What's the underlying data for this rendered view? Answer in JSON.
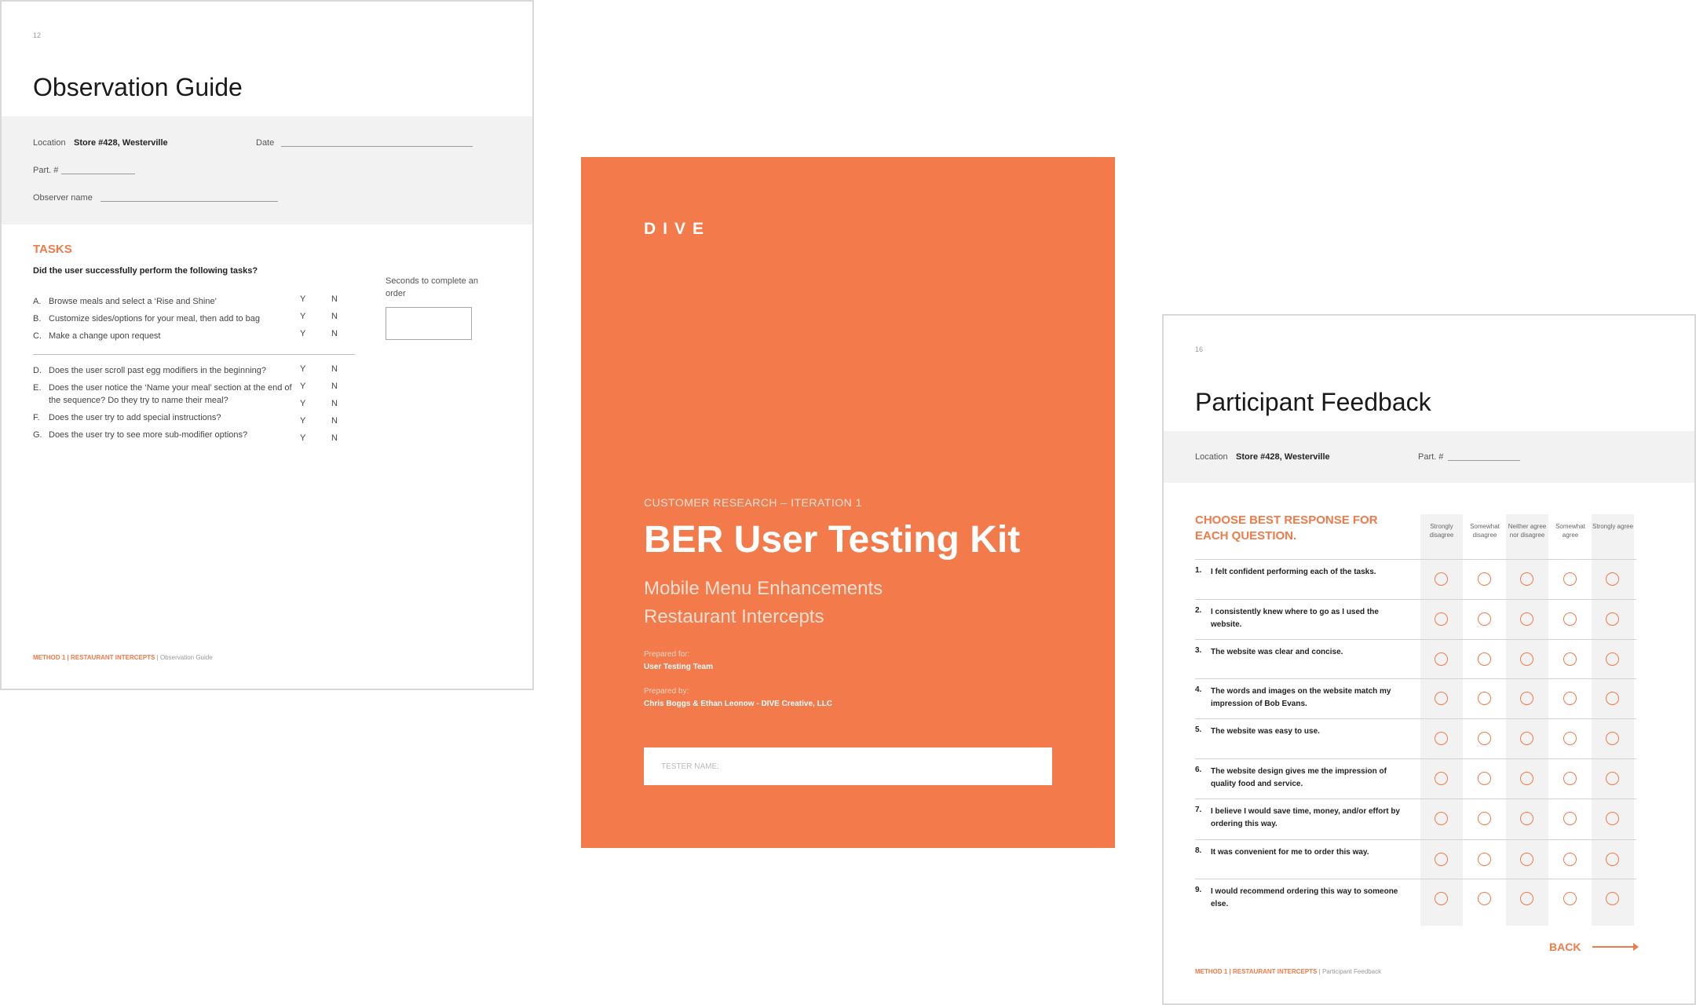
{
  "observation": {
    "page_number": "12",
    "title": "Observation Guide",
    "location_label": "Location",
    "location_value": "Store #428, Westerville",
    "date_label": "Date",
    "part_label": "Part. #",
    "observer_label": "Observer name",
    "tasks_heading": "TASKS",
    "tasks_question": "Did the user successfully perform the following tasks?",
    "seconds_label": "Seconds to complete an order",
    "yes": "Y",
    "no": "N",
    "tasks": [
      {
        "letter": "A.",
        "text": "Browse meals and select a ‘Rise and Shine’"
      },
      {
        "letter": "B.",
        "text": "Customize sides/options for your meal, then add to bag"
      },
      {
        "letter": "C.",
        "text": "Make a change upon request"
      },
      {
        "letter": "D.",
        "text": "Does the user scroll past egg modifiers in the beginning?"
      },
      {
        "letter": "E.",
        "text": "Does the user notice the ‘Name your meal’ section at the end of the sequence?  Do they try to name their meal?"
      },
      {
        "letter": "F.",
        "text": "Does the user try to add special instructions?"
      },
      {
        "letter": "G.",
        "text": "Does the user try to see more sub-modifier options?"
      }
    ],
    "footer_method": "METHOD 1 | RESTAURANT INTERCEPTS",
    "footer_page": " | Observation Guide"
  },
  "cover": {
    "brand": "DIVE",
    "eyebrow": "CUSTOMER RESEARCH – ITERATION 1",
    "title": "BER User Testing Kit",
    "subtitle_line1": "Mobile Menu Enhancements",
    "subtitle_line2": "Restaurant Intercepts",
    "prepared_for_label": "Prepared for:",
    "prepared_for_value": "User Testing Team",
    "prepared_by_label": "Prepared by:",
    "prepared_by_value": "Chris Boggs & Ethan Leonow - DIVE Creative, LLC",
    "tester_placeholder": "TESTER NAME:"
  },
  "feedback": {
    "page_number": "16",
    "title": "Participant Feedback",
    "location_label": "Location",
    "location_value": "Store #428, Westerville",
    "part_label": "Part. #",
    "choose_heading": "CHOOSE BEST RESPONSE FOR EACH QUESTION.",
    "scale": [
      "Strongly disagree",
      "Somewhat disagree",
      "Neither agree nor disagree",
      "Somewhat agree",
      "Strongly agree"
    ],
    "questions": [
      {
        "num": "1.",
        "text": "I felt confident performing each of the tasks."
      },
      {
        "num": "2.",
        "text": "I consistently knew where to go as I used the website."
      },
      {
        "num": "3.",
        "text": "The website was clear and concise."
      },
      {
        "num": "4.",
        "text": "The words and images on the website match my impression of Bob Evans."
      },
      {
        "num": "5.",
        "text": "The website was easy to use."
      },
      {
        "num": "6.",
        "text": "The website design gives me the impression of quality food and service."
      },
      {
        "num": "7.",
        "text": "I believe I would save time, money, and/or effort by ordering this way."
      },
      {
        "num": "8.",
        "text": "It was convenient for me to order this way."
      },
      {
        "num": "9.",
        "text": "I would recommend ordering this way to someone else."
      }
    ],
    "back_label": "BACK",
    "footer_method": "METHOD 1 | RESTAURANT INTERCEPTS",
    "footer_page": " | Participant Feedback"
  },
  "colors": {
    "accent": "#f27a4b",
    "band": "#f2f2f2"
  }
}
